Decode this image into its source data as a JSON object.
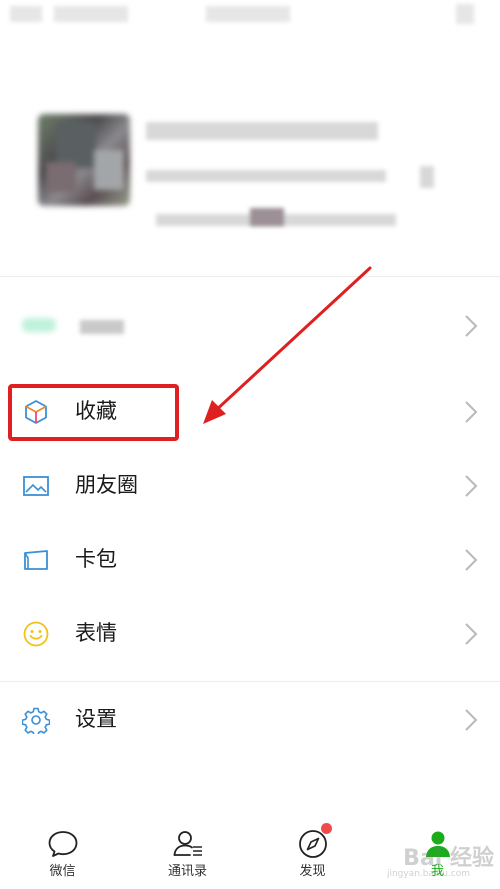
{
  "menu": {
    "items": [
      {
        "id": "pay",
        "label": "",
        "label_blurred": true
      },
      {
        "id": "favorites",
        "label": "收藏",
        "highlighted": true
      },
      {
        "id": "moments",
        "label": "朋友圈"
      },
      {
        "id": "card_wallet",
        "label": "卡包"
      },
      {
        "id": "stickers",
        "label": "表情"
      },
      {
        "id": "settings",
        "label": "设置"
      }
    ]
  },
  "tabbar": {
    "tabs": [
      {
        "label": "微信",
        "icon": "chat-icon"
      },
      {
        "label": "通讯录",
        "icon": "contacts-icon"
      },
      {
        "label": "发现",
        "icon": "compass-icon",
        "badge": "red-dot"
      },
      {
        "label": "我",
        "icon": "me-icon",
        "active": true
      }
    ]
  },
  "annotation": {
    "highlight_color": "#e02020",
    "arrow_color": "#e02020"
  },
  "watermark": {
    "text": "Bai 经验",
    "url": "jingyan.baidu.com"
  },
  "colors": {
    "active_tab": "#1aad19",
    "icon_blue": "#3a8fd6",
    "sticker_yellow": "#f2c21b",
    "badge_red": "#f24a4a"
  }
}
